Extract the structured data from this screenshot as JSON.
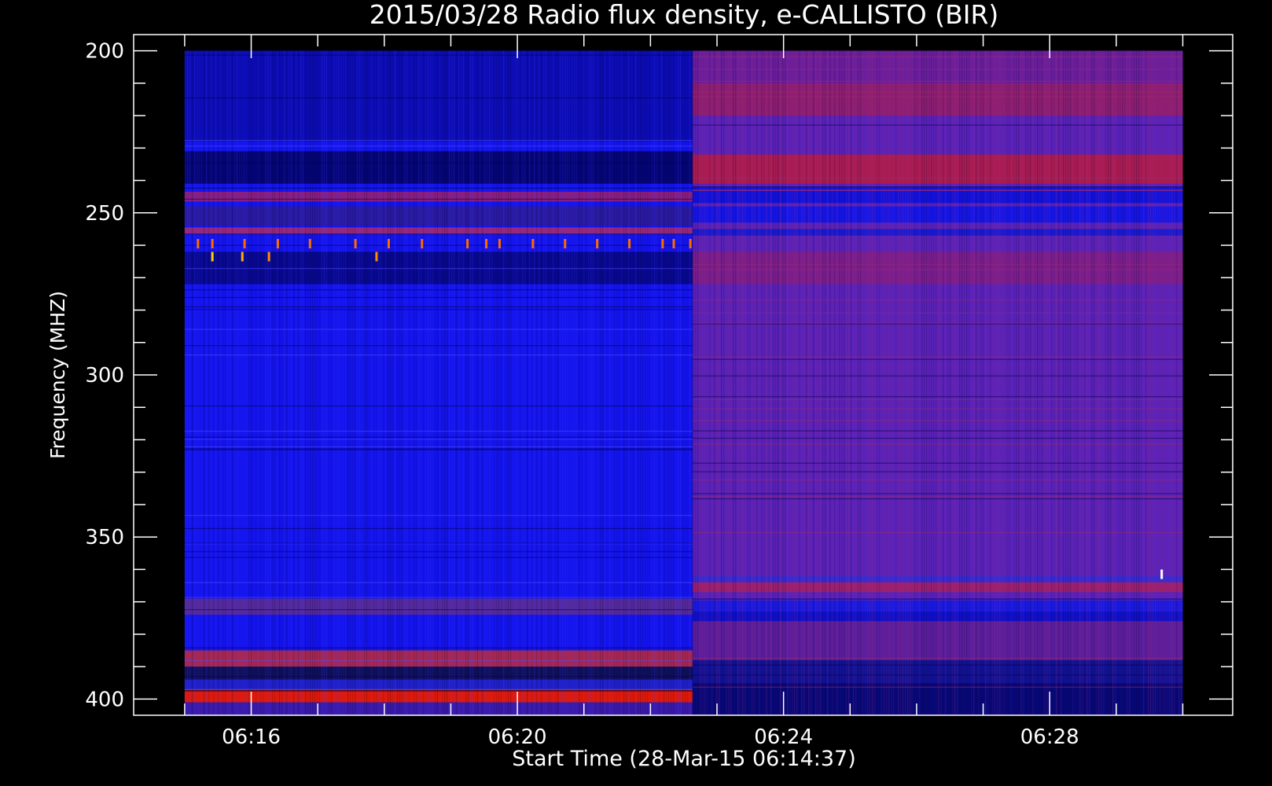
{
  "chart_data": {
    "type": "heatmap",
    "title": "2015/03/28  Radio flux density, e-CALLISTO (BIR)",
    "xlabel": "Start Time (28-Mar-15 06:14:37)",
    "ylabel": "Frequency (MHZ)",
    "x_unit": "time (HH:MM)",
    "xlim": [
      "06:14:14",
      "06:30:45"
    ],
    "data_xlim": [
      "06:15:00",
      "06:30:00"
    ],
    "ylim": [
      405,
      195
    ],
    "y_inverted": true,
    "data_ylim": [
      200,
      405
    ],
    "x_ticks": [
      "06:16",
      "06:20",
      "06:24",
      "06:28"
    ],
    "y_ticks": [
      200,
      250,
      300,
      350,
      400
    ],
    "grid": false,
    "colormap": [
      "#000000",
      "#0000c8",
      "#1212ff",
      "#7a1a9c",
      "#c81414",
      "#ff6000",
      "#ffd000",
      "#ffffff"
    ],
    "segments": [
      {
        "name": "",
        "time_start": "06:15:00",
        "time_end": "06:22:38",
        "background_color": "#1414ee",
        "bands": [
          {
            "f_start": 200,
            "f_end": 228,
            "color": "#0c0cb4"
          },
          {
            "f_start": 231,
            "f_end": 241,
            "color": "#050575"
          },
          {
            "f_start": 243.5,
            "f_end": 246.5,
            "color": "#8a1e7e"
          },
          {
            "f_start": 248,
            "f_end": 254,
            "color": "#2a1aa0"
          },
          {
            "f_start": 254.5,
            "f_end": 256.5,
            "color": "#9a2878"
          },
          {
            "f_start": 262,
            "f_end": 272,
            "color": "#08088e"
          },
          {
            "f_start": 369,
            "f_end": 374,
            "color": "#552a9a"
          },
          {
            "f_start": 385,
            "f_end": 390,
            "color": "#a82850"
          },
          {
            "f_start": 390,
            "f_end": 394,
            "color": "#10105a"
          },
          {
            "f_start": 394,
            "f_end": 397,
            "color": "#2020c8"
          },
          {
            "f_start": 397,
            "f_end": 401,
            "color": "#e01a0a"
          },
          {
            "f_start": 401,
            "f_end": 405,
            "color": "#3a1aa8"
          }
        ]
      },
      {
        "name": "",
        "time_start": "06:22:38",
        "time_end": "06:30:00",
        "background_color": "#5a22b8",
        "bands": [
          {
            "f_start": 200,
            "f_end": 210,
            "color": "#6a1e9c"
          },
          {
            "f_start": 210,
            "f_end": 220,
            "color": "#8c1e72"
          },
          {
            "f_start": 232,
            "f_end": 241,
            "color": "#a81c52"
          },
          {
            "f_start": 242,
            "f_end": 247,
            "color": "#1212dc"
          },
          {
            "f_start": 248,
            "f_end": 253,
            "color": "#1616e6"
          },
          {
            "f_start": 255,
            "f_end": 257,
            "color": "#1a1ad0"
          },
          {
            "f_start": 262,
            "f_end": 272,
            "color": "#7a1e8c"
          },
          {
            "f_start": 362,
            "f_end": 364,
            "color": "#3a2ad0"
          },
          {
            "f_start": 364,
            "f_end": 367,
            "color": "#9a2070"
          },
          {
            "f_start": 369,
            "f_end": 373,
            "color": "#1a1ae0"
          },
          {
            "f_start": 373,
            "f_end": 376,
            "color": "#1010c8"
          },
          {
            "f_start": 376,
            "f_end": 388,
            "color": "#5c1e9c"
          },
          {
            "f_start": 388,
            "f_end": 395,
            "color": "#121294"
          },
          {
            "f_start": 395,
            "f_end": 405,
            "color": "#080878"
          }
        ]
      }
    ],
    "bursts": [
      {
        "time": "06:15:12",
        "freq": 259.5,
        "color": "#ff6a00"
      },
      {
        "time": "06:15:25",
        "freq": 259.5,
        "color": "#ff6a00"
      },
      {
        "time": "06:15:54",
        "freq": 259.5,
        "color": "#ff6a00"
      },
      {
        "time": "06:16:24",
        "freq": 259.5,
        "color": "#ff6a00"
      },
      {
        "time": "06:16:53",
        "freq": 259.5,
        "color": "#ff6a00"
      },
      {
        "time": "06:17:34",
        "freq": 259.5,
        "color": "#ff6a00"
      },
      {
        "time": "06:18:04",
        "freq": 259.5,
        "color": "#ff6a00"
      },
      {
        "time": "06:18:34",
        "freq": 259.5,
        "color": "#ff6a00"
      },
      {
        "time": "06:19:15",
        "freq": 259.5,
        "color": "#ff6a00"
      },
      {
        "time": "06:19:32",
        "freq": 259.5,
        "color": "#ff6a00"
      },
      {
        "time": "06:19:44",
        "freq": 259.5,
        "color": "#ff6a00"
      },
      {
        "time": "06:20:14",
        "freq": 259.5,
        "color": "#ff6a00"
      },
      {
        "time": "06:20:43",
        "freq": 259.5,
        "color": "#ff6a00"
      },
      {
        "time": "06:21:12",
        "freq": 259.5,
        "color": "#ff6a00"
      },
      {
        "time": "06:21:41",
        "freq": 259.5,
        "color": "#ff6a00"
      },
      {
        "time": "06:22:11",
        "freq": 259.5,
        "color": "#ff6a00"
      },
      {
        "time": "06:22:21",
        "freq": 259.5,
        "color": "#ff6a00"
      },
      {
        "time": "06:22:36",
        "freq": 259.5,
        "color": "#ff6a00"
      },
      {
        "time": "06:15:25",
        "freq": 263.5,
        "color": "#ffd000"
      },
      {
        "time": "06:15:52",
        "freq": 263.5,
        "color": "#ffb000"
      },
      {
        "time": "06:16:16",
        "freq": 263.5,
        "color": "#ff8c00"
      },
      {
        "time": "06:17:53",
        "freq": 263.5,
        "color": "#ff8c00"
      },
      {
        "time": "06:29:41",
        "freq": 361.5,
        "color": "#ffffff"
      }
    ]
  }
}
